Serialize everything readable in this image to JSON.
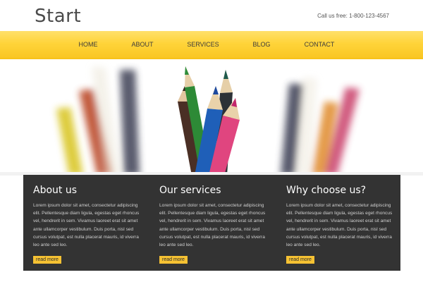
{
  "header": {
    "logo": "Start",
    "call_text": "Call us free:  1-800-123-4567"
  },
  "nav": {
    "items": [
      "HOME",
      "ABOUT",
      "SERVICES",
      "BLOG",
      "CONTACT"
    ]
  },
  "columns": [
    {
      "title": "About us",
      "body": "Lorem ipsum dolor sit amet, consectetur adipiscing elit. Pellentesque diam ligula, egestas eget rhoncus vel, hendrerit in sem. Vivamus laoreet erat sit amet ante ullamcorper vestibulum. Duis porta, nisl sed cursus volutpat, est nulla placerat mauris, id viverra leo ante sed leo.",
      "button": "read more"
    },
    {
      "title": "Our services",
      "body": "Lorem ipsum dolor sit amet, consectetur adipiscing elit. Pellentesque diam ligula, egestas eget rhoncus vel, hendrerit in sem. Vivamus laoreet erat sit amet ante ullamcorper vestibulum. Duis porta, nisl sed cursus volutpat, est nulla placerat mauris, id viverra leo ante sed leo.",
      "button": "read more"
    },
    {
      "title": "Why choose us?",
      "body": "Lorem ipsum dolor sit amet, consectetur adipiscing elit. Pellentesque diam ligula, egestas eget rhoncus vel, hendrerit in sem. Vivamus laoreet erat sit amet ante ullamcorper vestibulum. Duis porta, nisl sed cursus volutpat, est nulla placerat mauris, id viverra leo ante sed leo.",
      "button": "read more"
    }
  ],
  "colors": {
    "accent": "#ffd43a",
    "panel": "#333333",
    "button": "#f6c233"
  }
}
